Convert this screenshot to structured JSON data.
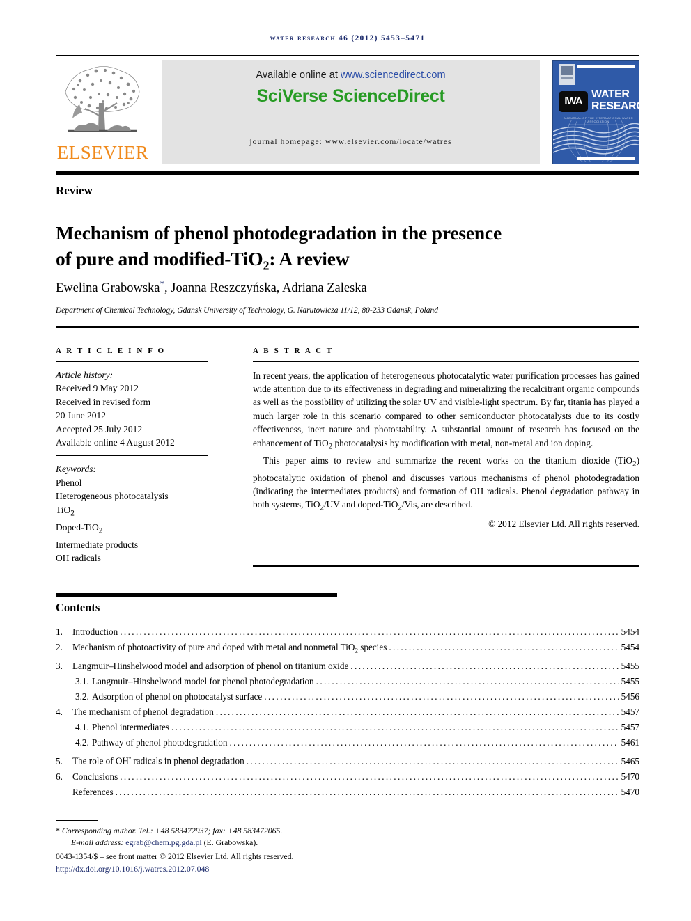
{
  "runhead": "water research 46 (2012) 5453–5471",
  "masthead": {
    "available_text": "Available online at ",
    "available_url": "www.sciencedirect.com",
    "brand": "SciVerse ScienceDirect",
    "homepage": "journal homepage: www.elsevier.com/locate/watres",
    "publisher_wordmark": "ELSEVIER",
    "cover": {
      "iwa": "IWA",
      "line1": "WATER",
      "line2": "RESEARCH",
      "tagline": "A JOURNAL OF THE INTERNATIONAL WATER ASSOCIATION"
    },
    "colors": {
      "brand_green": "#279b24",
      "link_blue": "#2c4ea8",
      "elsevier_orange": "#f08a1c",
      "cover_blue": "#2f5aa8",
      "band_gray": "#e3e3e3"
    }
  },
  "article": {
    "kind": "Review",
    "title_line1": "Mechanism of phenol photodegradation in the presence",
    "title_line2_a": "of pure and modified-TiO",
    "title_line2_sub": "2",
    "title_line2_b": ": A review",
    "authors_a": "Ewelina Grabowska",
    "authors_star": "*",
    "authors_b": ", Joanna Reszczyńska, Adriana Zaleska",
    "affiliation": "Department of Chemical Technology, Gdansk University of Technology, G. Narutowicza 11/12, 80-233 Gdansk, Poland"
  },
  "info": {
    "heading": "A R T I C L E  I N F O",
    "history_label": "Article history:",
    "history": [
      "Received 9 May 2012",
      "Received in revised form",
      "20 June 2012",
      "Accepted 25 July 2012",
      "Available online 4 August 2012"
    ],
    "keywords_label": "Keywords:",
    "keywords": [
      "Phenol",
      "Heterogeneous photocatalysis",
      "TiO2",
      "Doped-TiO2",
      "Intermediate products",
      "OH radicals"
    ]
  },
  "abstract": {
    "heading": "A B S T R A C T",
    "para1": "In recent years, the application of heterogeneous photocatalytic water purification processes has gained wide attention due to its effectiveness in degrading and mineralizing the recalcitrant organic compounds as well as the possibility of utilizing the solar UV and visible-light spectrum. By far, titania has played a much larger role in this scenario compared to other semiconductor photocatalysts due to its costly effectiveness, inert nature and photostability. A substantial amount of research has focused on the enhancement of TiO2 photocatalysis by modification with metal, non-metal and ion doping.",
    "para2": "This paper aims to review and summarize the recent works on the titanium dioxide (TiO2) photocatalytic oxidation of phenol and discusses various mechanisms of phenol photodegradation (indicating the intermediates products) and formation of OH radicals. Phenol degradation pathway in both systems, TiO2/UV and doped-TiO2/Vis, are described.",
    "copyright": "© 2012 Elsevier Ltd. All rights reserved."
  },
  "contents": {
    "heading": "Contents",
    "items": [
      {
        "num": "1.",
        "sub": false,
        "label": "Introduction",
        "page": "5454"
      },
      {
        "num": "2.",
        "sub": false,
        "label": "Mechanism of photoactivity of pure and doped with metal and nonmetal TiO2 species",
        "page": "5454"
      },
      {
        "num": "3.",
        "sub": false,
        "label": "Langmuir–Hinshelwood model and adsorption of phenol on titanium oxide",
        "page": "5455"
      },
      {
        "num": "3.1.",
        "sub": true,
        "label": "Langmuir–Hinshelwood model for phenol photodegradation",
        "page": "5455"
      },
      {
        "num": "3.2.",
        "sub": true,
        "label": "Adsorption of phenol on photocatalyst surface",
        "page": "5456"
      },
      {
        "num": "4.",
        "sub": false,
        "label": "The mechanism of phenol degradation",
        "page": "5457"
      },
      {
        "num": "4.1.",
        "sub": true,
        "label": "Phenol intermediates",
        "page": "5457"
      },
      {
        "num": "4.2.",
        "sub": true,
        "label": "Pathway of phenol photodegradation",
        "page": "5461"
      },
      {
        "num": "5.",
        "sub": false,
        "label": "The role of OH• radicals in phenol degradation",
        "page": "5465"
      },
      {
        "num": "6.",
        "sub": false,
        "label": "Conclusions",
        "page": "5470"
      },
      {
        "num": "",
        "sub": false,
        "label": "References",
        "page": "5470"
      }
    ]
  },
  "footnotes": {
    "corresponding": "Corresponding author. Tel.: +48 583472937; fax: +48 583472065.",
    "email_label": "E-mail address: ",
    "email": "egrab@chem.pg.gda.pl",
    "email_suffix": " (E. Grabowska).",
    "front_matter": "0043-1354/$ – see front matter © 2012 Elsevier Ltd. All rights reserved.",
    "doi": "http://dx.doi.org/10.1016/j.watres.2012.07.048"
  }
}
